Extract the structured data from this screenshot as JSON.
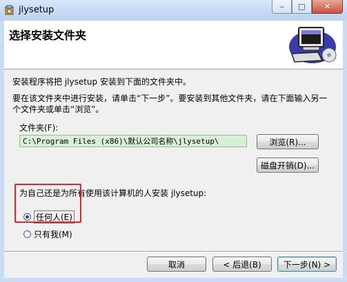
{
  "window": {
    "title": "jlysetup",
    "buttons": {
      "minimize": "‒",
      "maximize": "□",
      "close": "✕"
    }
  },
  "header": {
    "title": "选择安装文件夹"
  },
  "body": {
    "line1": "安装程序将把 jlysetup 安装到下面的文件夹中。",
    "line2": "要在该文件夹中进行安装，请单击“下一步”。要安装到其他文件夹，请在下面输入另一",
    "line3": "个文件夹或单击“浏览”。"
  },
  "folder": {
    "label": "文件夹(F):",
    "value": "C:\\Program Files (x86)\\默认公司名称\\jlysetup\\",
    "browse_label": "浏览(R)...",
    "disk_cost_label": "磁盘开销(D)..."
  },
  "install_for": {
    "question": "为自己还是为所有使用该计算机的人安装 jlysetup:",
    "options": [
      {
        "label": "任何人(E)",
        "checked": true
      },
      {
        "label": "只有我(M)",
        "checked": false
      }
    ]
  },
  "footer": {
    "cancel_label": "取消",
    "back_label": "< 后退(B)",
    "next_label": "下一步(N) >"
  },
  "colors": {
    "highlight_box": "#e0262b",
    "path_field_bg": "#d6efd5"
  }
}
